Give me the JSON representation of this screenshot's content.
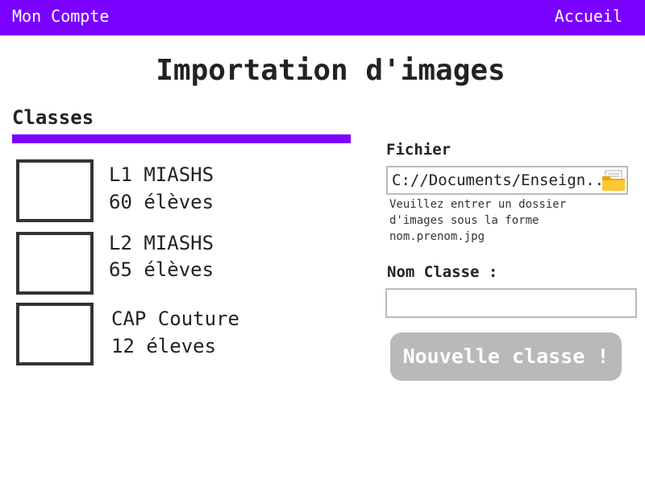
{
  "header": {
    "account_label": "Mon Compte",
    "home_label": "Accueil",
    "background_color": "#7a00ff"
  },
  "page": {
    "title": "Importation d'images"
  },
  "classes": {
    "heading": "Classes",
    "accent_color": "#7a00ff",
    "items": [
      {
        "name": "L1 MIASHS",
        "count": "60 élèves",
        "checked": false
      },
      {
        "name": "L2 MIASHS",
        "count": "65 élèves",
        "checked": false
      },
      {
        "name": "CAP Couture",
        "count": "12 éleves",
        "checked": false
      }
    ]
  },
  "import_form": {
    "file_label": "Fichier",
    "file_value": "C://Documents/Enseign...",
    "file_icon": "folder-icon",
    "hint_lines": [
      "Veuillez entrer un dossier",
      "d'images sous la forme",
      "nom.prenom.jpg"
    ],
    "classname_label": "Nom Classe :",
    "classname_value": "",
    "submit_label": "Nouvelle classe !",
    "submit_color": "#b9b9b9"
  }
}
